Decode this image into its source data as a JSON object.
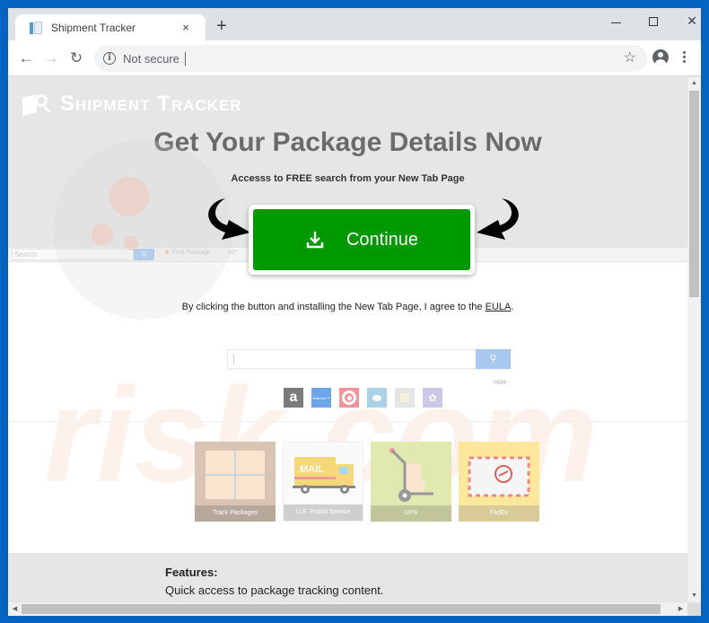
{
  "browser": {
    "tab_title": "Shipment Tracker",
    "tab_close_glyph": "×",
    "new_tab_glyph": "+",
    "address_status": "Not secure",
    "address_url": "",
    "icons": {
      "back": "arrow-left-icon",
      "forward": "arrow-right-icon",
      "reload": "reload-icon",
      "info": "info-icon",
      "bookmark": "star-icon",
      "profile": "account-icon",
      "menu": "kebab-menu-icon"
    },
    "glyphs": {
      "back": "←",
      "forward": "→",
      "reload": "↻",
      "info": "i",
      "star": "☆",
      "close": "✕",
      "scroll_up": "▲",
      "scroll_down": "▼",
      "scroll_left": "◀",
      "scroll_right": "▶"
    }
  },
  "page": {
    "brand_name": "Shipment Tracker",
    "headline": "Get Your Package Details Now",
    "subline": "Accesss to FREE search from your New Tab Page",
    "cta_label": "Continue",
    "agree_text": "By clicking the button and installing the New Tab Page, I agree to the ",
    "eula_link": "EULA",
    "agree_suffix": ".",
    "fake_toolbar": {
      "search_placeholder": "Search",
      "search_glyph": "🔍",
      "find_package": "Find Package",
      "weather": "83°"
    },
    "preview_search": {
      "button_glyph": "⚲",
      "hide_link": "Hide"
    },
    "quick_links": [
      {
        "name": "amazon",
        "glyph": "a"
      },
      {
        "name": "walmart",
        "glyph": "Walmart ✳"
      },
      {
        "name": "target",
        "glyph": ""
      },
      {
        "name": "chat",
        "glyph": ""
      },
      {
        "name": "notes",
        "glyph": ""
      },
      {
        "name": "charity",
        "glyph": "✿"
      }
    ],
    "tiles": [
      {
        "label": "Track Packages"
      },
      {
        "label": "U.S. Postal Service",
        "art_text": "MAIL"
      },
      {
        "label": "UPS"
      },
      {
        "label": "FedEx"
      }
    ],
    "features_title": "Features:",
    "features_text": "Quick access to package tracking content."
  },
  "colors": {
    "cta_green": "#009900",
    "hero_bg": "#e6e6e6",
    "frame_blue": "#0563c1"
  }
}
